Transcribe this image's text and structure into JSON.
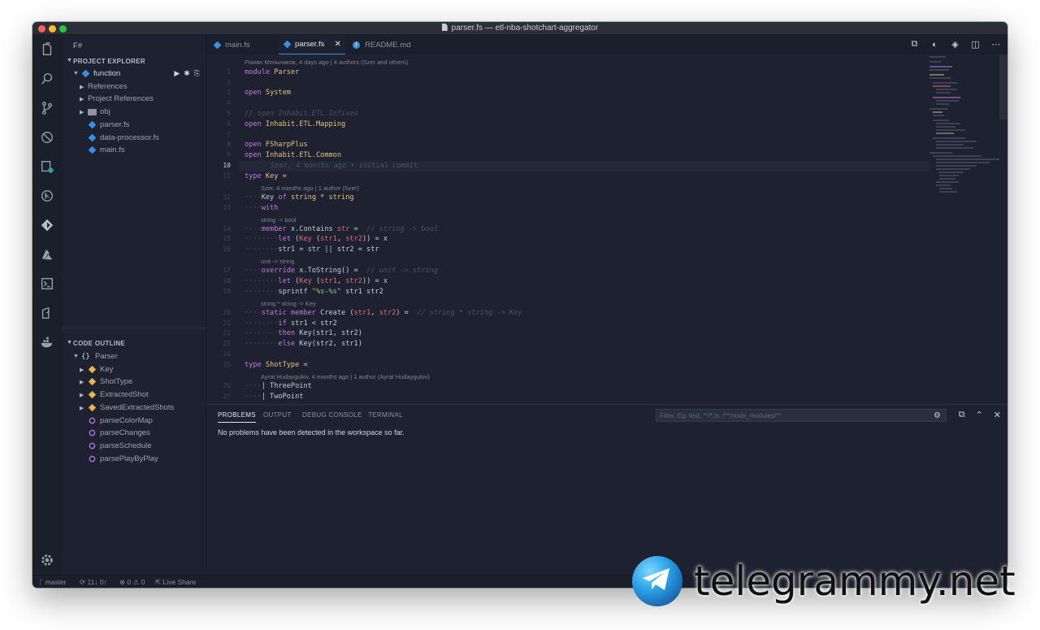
{
  "window": {
    "title": "parser.fs — etl-nba-shotchart-aggregator"
  },
  "sidebar": {
    "title": "F#",
    "project_explorer": {
      "header": "PROJECT EXPLORER",
      "project": "function",
      "items": [
        {
          "label": "References",
          "icon": "chevron-right-icon"
        },
        {
          "label": "Project References",
          "icon": "chevron-right-icon"
        },
        {
          "label": "obj",
          "icon": "folder-icon"
        },
        {
          "label": "parser.fs",
          "icon": "fsharp-file-icon"
        },
        {
          "label": "data-processor.fs",
          "icon": "fsharp-file-icon"
        },
        {
          "label": "main.fs",
          "icon": "fsharp-file-icon"
        }
      ]
    },
    "code_outline": {
      "header": "CODE OUTLINE",
      "root": "Parser",
      "items": [
        {
          "label": "Key",
          "kind": "type"
        },
        {
          "label": "ShotType",
          "kind": "type"
        },
        {
          "label": "ExtractedShot",
          "kind": "type"
        },
        {
          "label": "SavedExtractedShots",
          "kind": "type"
        },
        {
          "label": "parseColorMap",
          "kind": "function"
        },
        {
          "label": "parseChanges",
          "kind": "function"
        },
        {
          "label": "parseSchedule",
          "kind": "function"
        },
        {
          "label": "parsePlayByPlay",
          "kind": "function"
        }
      ]
    }
  },
  "editor": {
    "tabs": [
      {
        "label": "main.fs",
        "active": false
      },
      {
        "label": "parser.fs",
        "active": true
      },
      {
        "label": "README.md",
        "active": false
      }
    ],
    "close_glyph": "✕",
    "codelens": {
      "top": "Роман Мельников, 4 days ago | 4 authors (Szer and others)",
      "key": "Szer, 4 months ago | 1 author (Szer)",
      "contains_sig": "string -> bool",
      "tostring_sig": "unit -> string",
      "create_sig": "string * string -> Key",
      "shottype": "Ayrat Hudaygulov, 4 months ago | 1 author (Ayrat Hudaygulov)"
    },
    "blame": "Szer, 4 months ago • initial commit",
    "current_line_number": "10",
    "accent": "#3a8ee6"
  },
  "panel": {
    "tabs": [
      "PROBLEMS",
      "OUTPUT",
      "DEBUG CONSOLE",
      "TERMINAL"
    ],
    "filter_placeholder": "Filter. Eg: text, **/*.ts, !**/node_modules/**",
    "message": "No problems have been detected in the workspace so far."
  },
  "statusbar": {
    "branch": "master",
    "sync": "11↓ 0↑",
    "errors": "0",
    "warnings": "0",
    "live_share": "Live Share"
  },
  "watermark": {
    "text": "telegrammy.net"
  }
}
